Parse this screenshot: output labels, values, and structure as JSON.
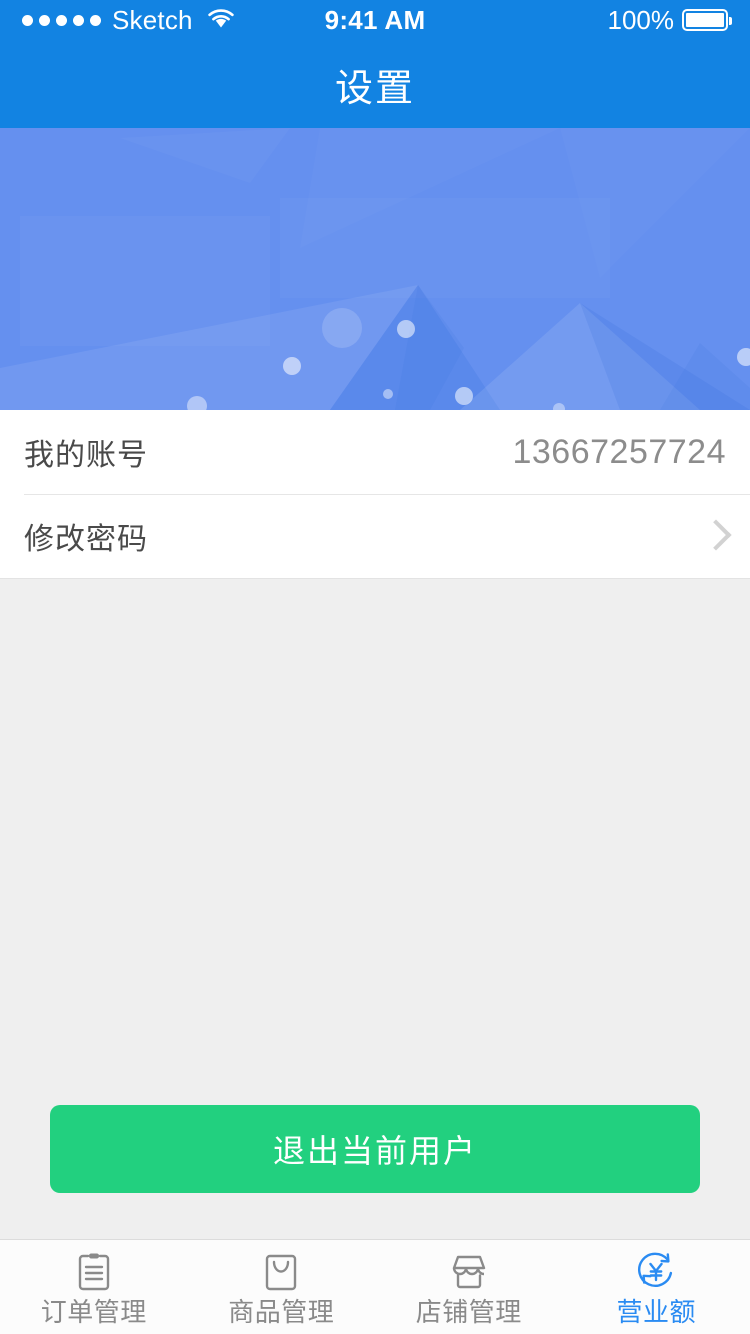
{
  "status_bar": {
    "carrier": "Sketch",
    "signal_dots": 5,
    "wifi_icon": "wifi-icon",
    "time": "9:41 AM",
    "battery_percent": "100%",
    "battery_icon": "battery-full-icon"
  },
  "navbar": {
    "title": "设置"
  },
  "banner": {
    "name": "profile-banner",
    "base_color": "#6590ef",
    "accent_color": "#7ba3f4"
  },
  "settings_list": [
    {
      "label": "我的账号",
      "value": "13667257724",
      "accessory": "none"
    },
    {
      "label": "修改密码",
      "value": "",
      "accessory": "chevron-right-icon"
    }
  ],
  "logout": {
    "label": "退出当前用户",
    "color": "#22d07f"
  },
  "tabbar": {
    "active_color": "#2a8bf2",
    "inactive_color": "#8a8a8a",
    "items": [
      {
        "label": "订单管理",
        "icon": "clipboard-icon",
        "active": false
      },
      {
        "label": "商品管理",
        "icon": "shopping-bag-icon",
        "active": false
      },
      {
        "label": "店铺管理",
        "icon": "storefront-icon",
        "active": false
      },
      {
        "label": "营业额",
        "icon": "yen-refresh-icon",
        "active": true
      }
    ]
  },
  "theme": {
    "primary": "#1283e2",
    "page_background": "#efefef",
    "card_background": "#ffffff"
  }
}
